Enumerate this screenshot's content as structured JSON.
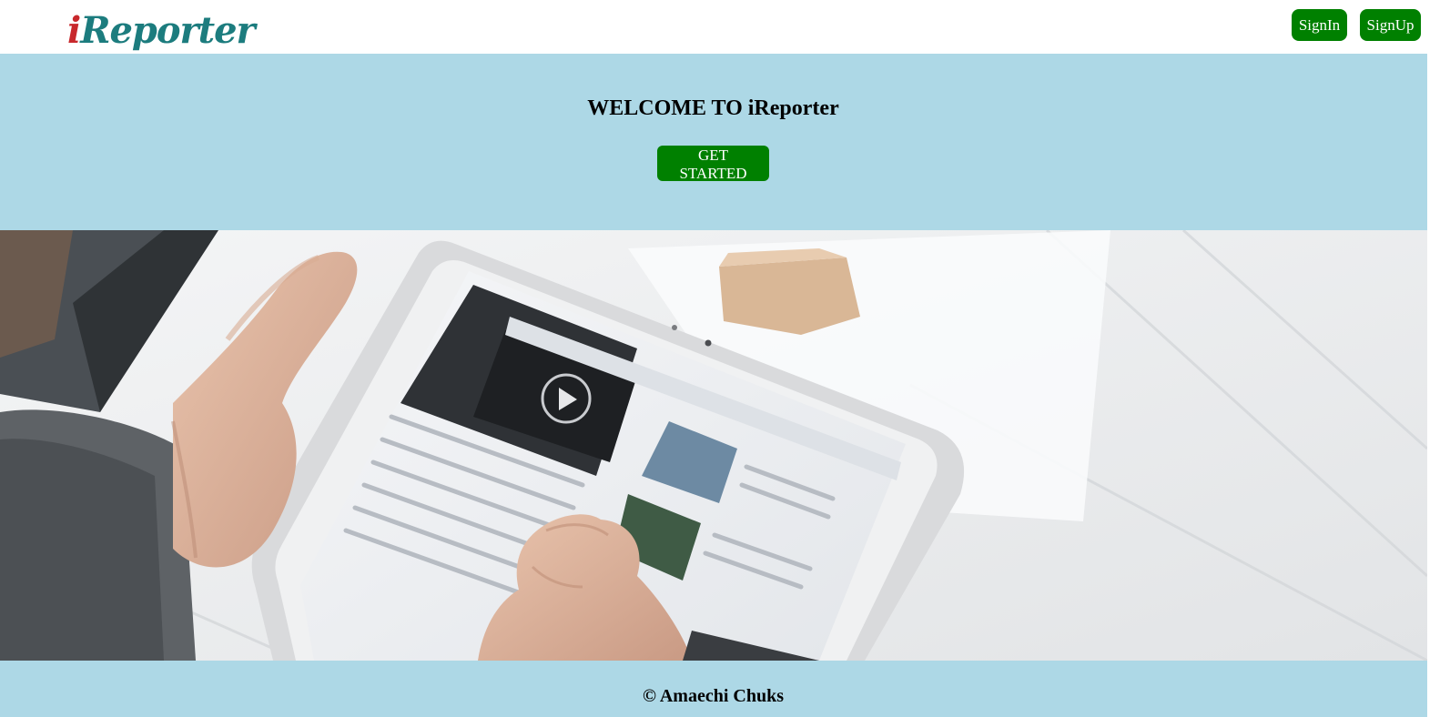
{
  "header": {
    "logo": {
      "first_letter": "i",
      "rest": "Reporter"
    },
    "signin_label": "SignIn",
    "signup_label": "SignUp"
  },
  "hero": {
    "title": "WELCOME TO iReporter",
    "cta_label": "GET STARTED"
  },
  "banner": {
    "image_description_icon": "tablet-news-photo"
  },
  "footer": {
    "copyright": "© Amaechi Chuks"
  },
  "colors": {
    "hero_bg": "#add8e6",
    "button_green": "#008000",
    "logo_red": "#c8282c",
    "logo_teal": "#1c7c7e"
  }
}
